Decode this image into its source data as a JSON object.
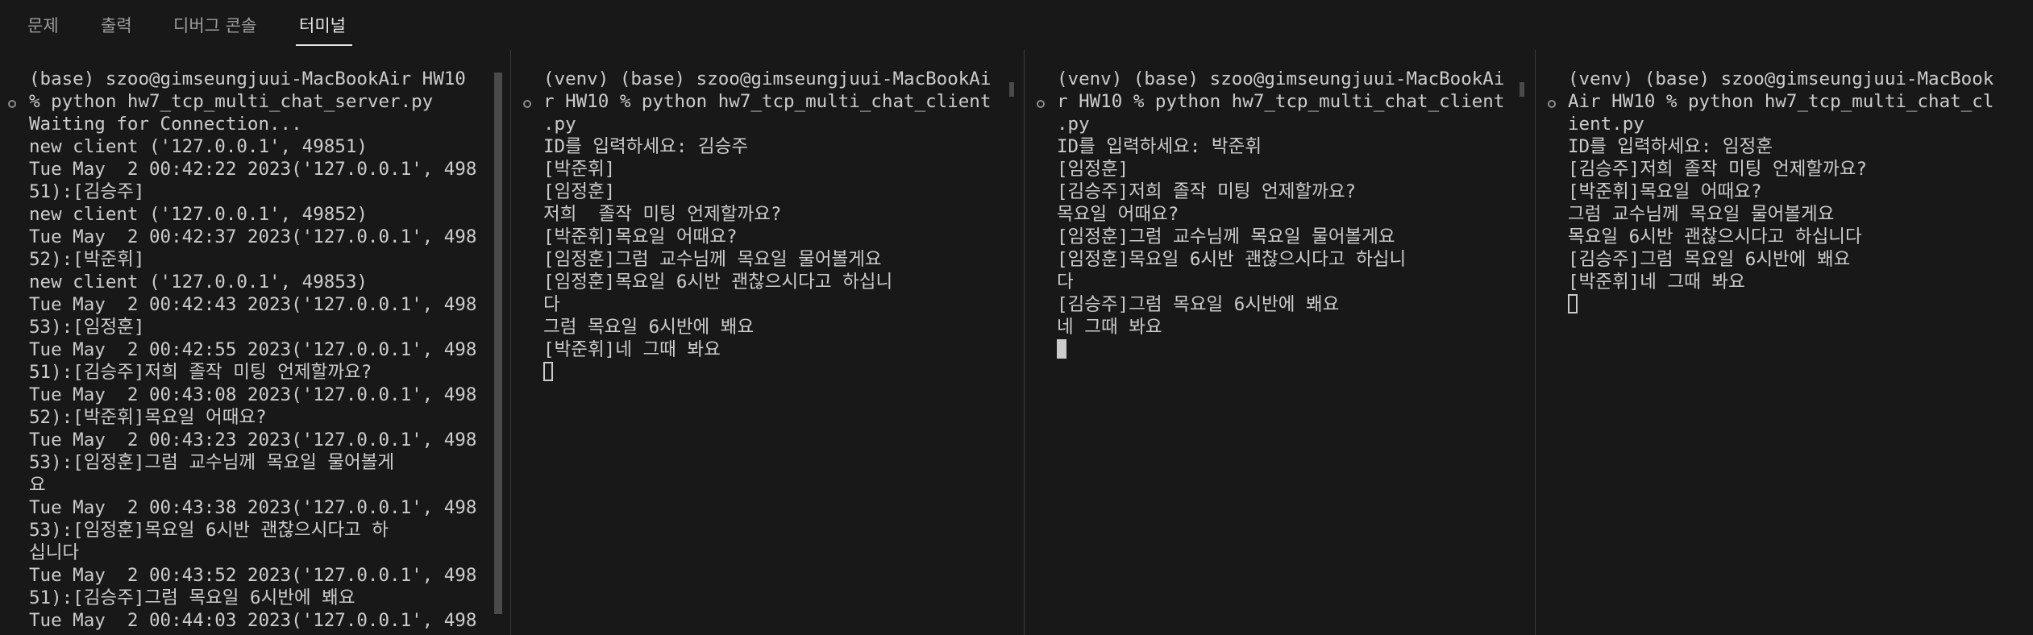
{
  "panel_tabs": [
    {
      "label": "문제",
      "active": false
    },
    {
      "label": "출력",
      "active": false
    },
    {
      "label": "디버그 콘솔",
      "active": false
    },
    {
      "label": "터미널",
      "active": true
    }
  ],
  "terminals": [
    {
      "name": "server",
      "lines": [
        "(base) szoo@gimseungjuui-MacBookAir HW10",
        "% python hw7_tcp_multi_chat_server.py",
        "Waiting for Connection...",
        "new client ('127.0.0.1', 49851)",
        "Tue May  2 00:42:22 2023('127.0.0.1', 498",
        "51):[김승주]",
        "new client ('127.0.0.1', 49852)",
        "Tue May  2 00:42:37 2023('127.0.0.1', 498",
        "52):[박준휘]",
        "new client ('127.0.0.1', 49853)",
        "Tue May  2 00:42:43 2023('127.0.0.1', 498",
        "53):[임정훈]",
        "Tue May  2 00:42:55 2023('127.0.0.1', 498",
        "51):[김승주]저희 졸작 미팅 언제할까요?",
        "Tue May  2 00:43:08 2023('127.0.0.1', 498",
        "52):[박준휘]목요일 어때요?",
        "Tue May  2 00:43:23 2023('127.0.0.1', 498",
        "53):[임정훈]그럼 교수님께 목요일 물어볼게",
        "요",
        "Tue May  2 00:43:38 2023('127.0.0.1', 498",
        "53):[임정훈]목요일 6시반 괜찮으시다고 하",
        "십니다",
        "Tue May  2 00:43:52 2023('127.0.0.1', 498",
        "51):[김승주]그럼 목요일 6시반에 봬요",
        "Tue May  2 00:44:03 2023('127.0.0.1', 498"
      ],
      "cursor": "none"
    },
    {
      "name": "client-1",
      "lines": [
        "(venv) (base) szoo@gimseungjuui-MacBookAi",
        "r HW10 % python hw7_tcp_multi_chat_client",
        ".py",
        "ID를 입력하세요: 김승주",
        "[박준휘]",
        "[임정훈]",
        "저희  졸작 미팅 언제할까요?",
        "[박준휘]목요일 어때요?",
        "[임정훈]그럼 교수님께 목요일 물어볼게요",
        "[임정훈]목요일 6시반 괜찮으시다고 하십니",
        "다",
        "그럼 목요일 6시반에 봬요",
        "[박준휘]네 그때 봐요"
      ],
      "cursor": "hollow"
    },
    {
      "name": "client-2",
      "lines": [
        "(venv) (base) szoo@gimseungjuui-MacBookAi",
        "r HW10 % python hw7_tcp_multi_chat_client",
        ".py",
        "ID를 입력하세요: 박준휘",
        "[임정훈]",
        "[김승주]저희 졸작 미팅 언제할까요?",
        "목요일 어때요?",
        "[임정훈]그럼 교수님께 목요일 물어볼게요",
        "[임정훈]목요일 6시반 괜찮으시다고 하십니",
        "다",
        "[김승주]그럼 목요일 6시반에 봬요",
        "네 그때 봐요"
      ],
      "cursor": "solid"
    },
    {
      "name": "client-3",
      "lines": [
        "(venv) (base) szoo@gimseungjuui-MacBook",
        "Air HW10 % python hw7_tcp_multi_chat_cl",
        "ient.py",
        "ID를 입력하세요: 임정훈",
        "[김승주]저희 졸작 미팅 언제할까요?",
        "[박준휘]목요일 어때요?",
        "그럼 교수님께 목요일 물어볼게요",
        "목요일 6시반 괜찮으시다고 하십니다",
        "[김승주]그럼 목요일 6시반에 봬요",
        "[박준휘]네 그때 봐요"
      ],
      "cursor": "hollow"
    }
  ]
}
